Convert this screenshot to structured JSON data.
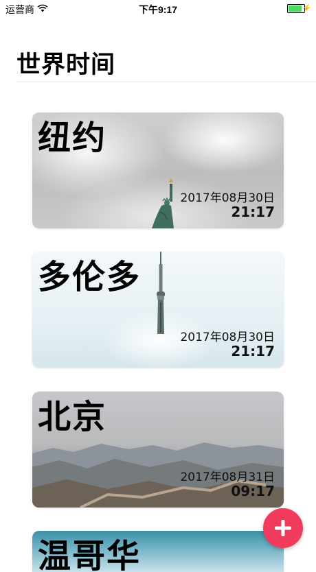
{
  "status_bar": {
    "carrier": "运营商",
    "time": "下午9:17",
    "battery_level": 0.9,
    "battery_color": "#4cd964"
  },
  "header": {
    "title": "世界时间"
  },
  "cities": [
    {
      "name": "纽约",
      "date": "2017年08月30日",
      "time": "21:17"
    },
    {
      "name": "多伦多",
      "date": "2017年08月30日",
      "time": "21:17"
    },
    {
      "name": "北京",
      "date": "2017年08月31日",
      "time": "09:17"
    },
    {
      "name": "温哥华"
    }
  ],
  "add_button": {
    "icon": "plus-icon",
    "color": "#f03b5c"
  }
}
